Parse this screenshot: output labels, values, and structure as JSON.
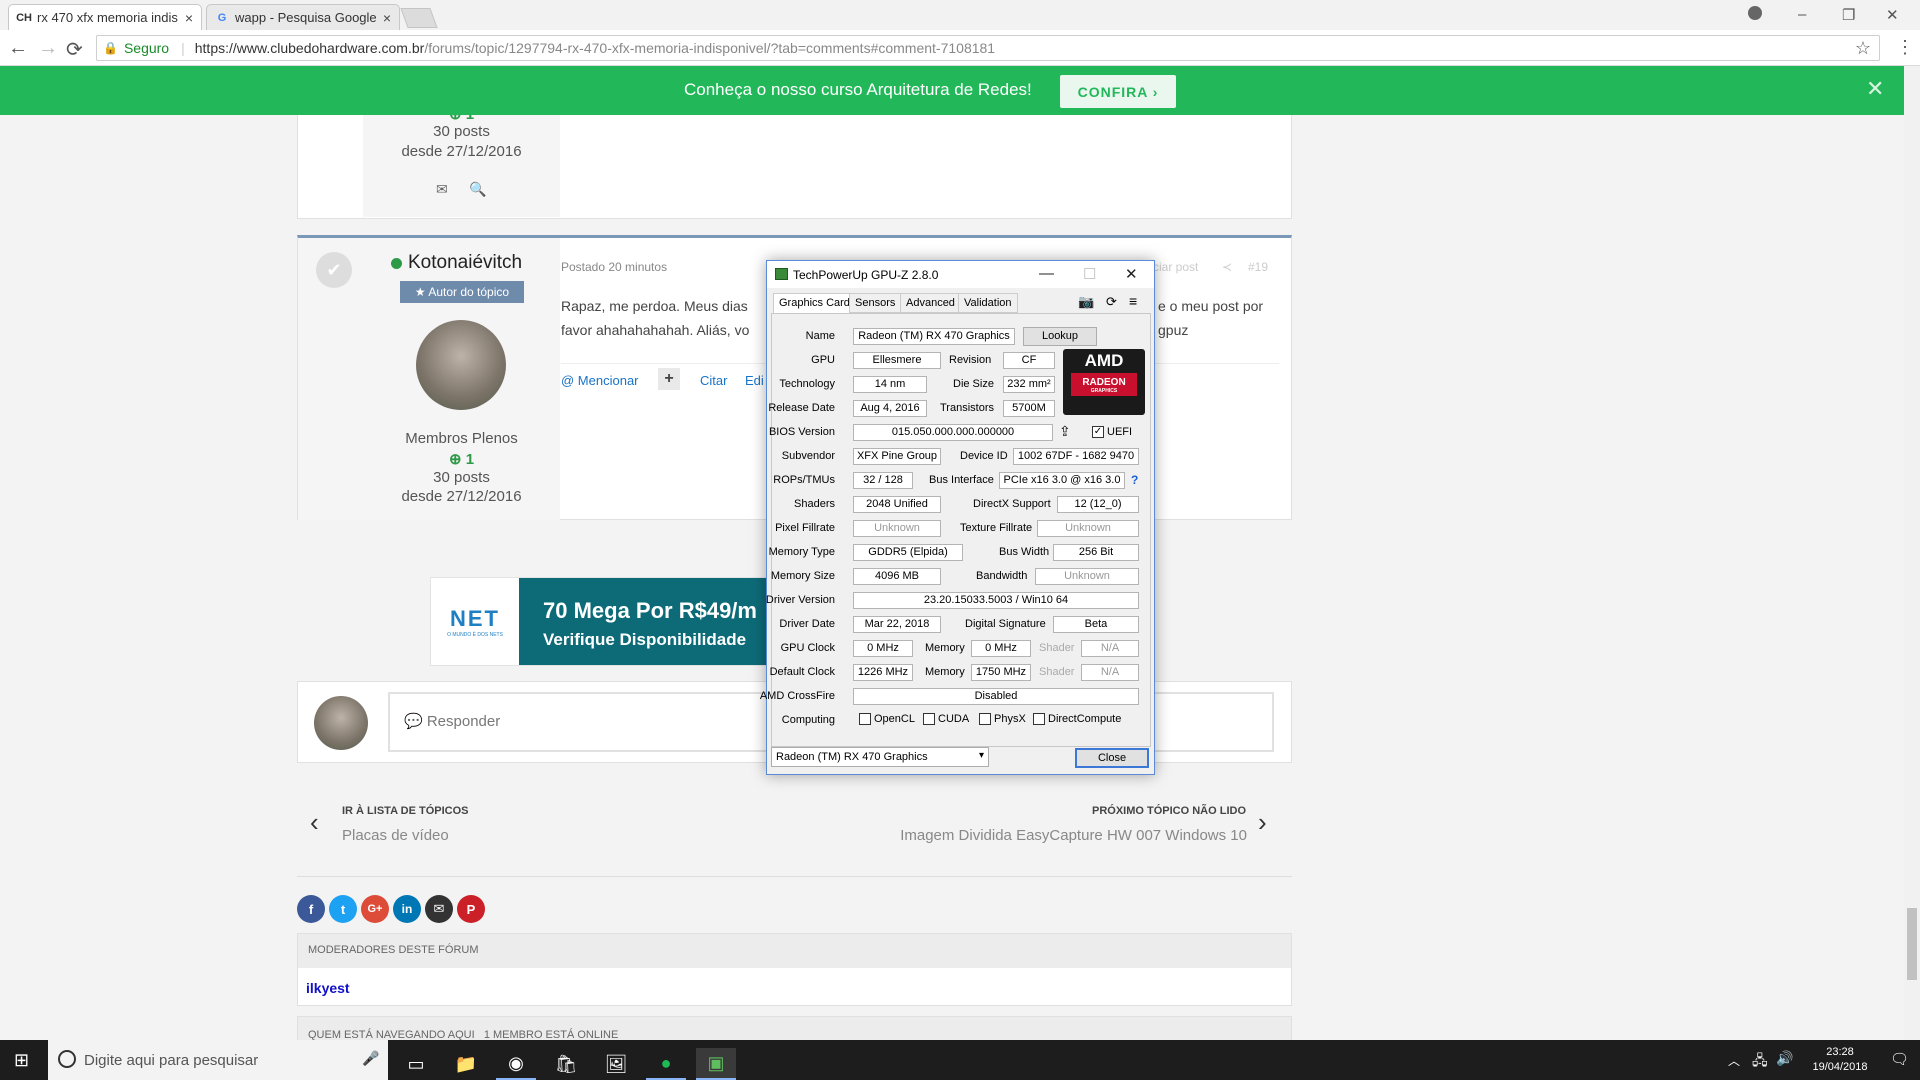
{
  "browser": {
    "tabs": [
      {
        "favicon": "CH",
        "title": "rx 470 xfx memoria indis",
        "close": "×"
      },
      {
        "favicon": "G",
        "title": "wapp - Pesquisa Google",
        "close": "×"
      }
    ],
    "window_controls": {
      "minimize": "–",
      "maximize": "❐",
      "close": "✕"
    },
    "nav": {
      "back": "←",
      "forward": "→",
      "reload": "⟳",
      "star": "☆",
      "menu": "⋮"
    },
    "security_label": "Seguro",
    "url_host": "https://www.clubedohardware.com.br",
    "url_path": "/forums/topic/1297794-rx-470-xfx-memoria-indisponivel/?tab=comments#comment-7108181"
  },
  "promo": {
    "text": "Conheça o nosso curso Arquitetura de Redes!",
    "button": "CONFIRA ›",
    "close": "✕"
  },
  "post_above": {
    "rep": "1",
    "posts": "30 posts",
    "since": "desde 27/12/2016"
  },
  "post": {
    "author": "Kotonaiévitch",
    "badge": "★ Autor do tópico",
    "posted": "Postado 20 minutos",
    "share_text": "ciar post",
    "post_number": "#19",
    "body_line1": "Rapaz, me perdoa. Meus dias",
    "body_line1_end": "e o meu post por",
    "body_line2": "favor ahahahahahah. Aliás, vo",
    "body_line2_end": "gpuz",
    "group": "Membros Plenos",
    "rep": "1",
    "posts": "30 posts",
    "since": "desde 27/12/2016",
    "mention": "@ Mencionar",
    "plus": "+",
    "quote": "Citar",
    "edit": "Edi"
  },
  "ad": {
    "logo": "NET",
    "logo_sub": "O MUNDO É DOS NETS",
    "headline": "70 Mega Por R$49/m",
    "sub": "Verifique Disponibilidade"
  },
  "reply": {
    "placeholder": "💬 Responder"
  },
  "pager": {
    "prev_label": "IR À LISTA DE TÓPICOS",
    "prev_link": "Placas de vídeo",
    "next_label": "PRÓXIMO TÓPICO NÃO LIDO",
    "next_link": "Imagem Dividida EasyCapture HW 007 Windows 10"
  },
  "share_icons": [
    "f",
    "t",
    "G+",
    "in",
    "✉",
    "P"
  ],
  "moderators": {
    "title": "MODERADORES DESTE FÓRUM",
    "name": "ilkyest"
  },
  "browsing": {
    "title": "QUEM ESTÁ NAVEGANDO AQUI   1 MEMBRO ESTÁ ONLINE"
  },
  "taskbar": {
    "search_placeholder": "Digite aqui para pesquisar",
    "time": "23:28",
    "date": "19/04/2018"
  },
  "gpuz": {
    "title": "TechPowerUp GPU-Z 2.8.0",
    "tabs": [
      "Graphics Card",
      "Sensors",
      "Advanced",
      "Validation"
    ],
    "name": "Radeon (TM) RX 470 Graphics",
    "lookup": "Lookup",
    "gpu": "Ellesmere",
    "revision": "CF",
    "technology": "14 nm",
    "die_size": "232 mm²",
    "release_date": "Aug 4, 2016",
    "transistors": "5700M",
    "bios": "015.050.000.000.000000",
    "uefi": "UEFI",
    "subvendor": "XFX Pine Group",
    "device_id": "1002 67DF - 1682 9470",
    "rops": "32 / 128",
    "bus_interface": "PCIe x16 3.0 @ x16 3.0",
    "help": "?",
    "shaders": "2048 Unified",
    "directx": "12 (12_0)",
    "pixel_fillrate": "Unknown",
    "texture_fillrate": "Unknown",
    "memory_type": "GDDR5 (Elpida)",
    "bus_width": "256 Bit",
    "memory_size": "4096 MB",
    "bandwidth": "Unknown",
    "driver_version": "23.20.15033.5003 / Win10 64",
    "driver_date": "Mar 22, 2018",
    "digital_signature": "Beta",
    "gpu_clock": "0 MHz",
    "memory_clock": "0 MHz",
    "shader_clock": "N/A",
    "default_clock": "1226 MHz",
    "default_memory": "1750 MHz",
    "default_shader": "N/A",
    "crossfire": "Disabled",
    "computing": [
      "OpenCL",
      "CUDA",
      "PhysX",
      "DirectCompute"
    ],
    "selected_gpu": "Radeon (TM) RX 470 Graphics",
    "close": "Close",
    "labels": {
      "name": "Name",
      "gpu": "GPU",
      "revision": "Revision",
      "technology": "Technology",
      "die_size": "Die Size",
      "release_date": "Release Date",
      "transistors": "Transistors",
      "bios": "BIOS Version",
      "subvendor": "Subvendor",
      "device_id": "Device ID",
      "rops": "ROPs/TMUs",
      "bus_interface": "Bus Interface",
      "shaders": "Shaders",
      "directx": "DirectX Support",
      "pixel_fillrate": "Pixel Fillrate",
      "texture_fillrate": "Texture Fillrate",
      "memory_type": "Memory Type",
      "bus_width": "Bus Width",
      "memory_size": "Memory Size",
      "bandwidth": "Bandwidth",
      "driver_version": "Driver Version",
      "driver_date": "Driver Date",
      "digital_signature": "Digital Signature",
      "gpu_clock": "GPU Clock",
      "memory": "Memory",
      "shader": "Shader",
      "default_clock": "Default Clock",
      "crossfire": "AMD CrossFire",
      "computing": "Computing"
    },
    "amd_logo": "AMD",
    "radeon_logo": "RADEON",
    "radeon_sub": "GRAPHICS"
  }
}
